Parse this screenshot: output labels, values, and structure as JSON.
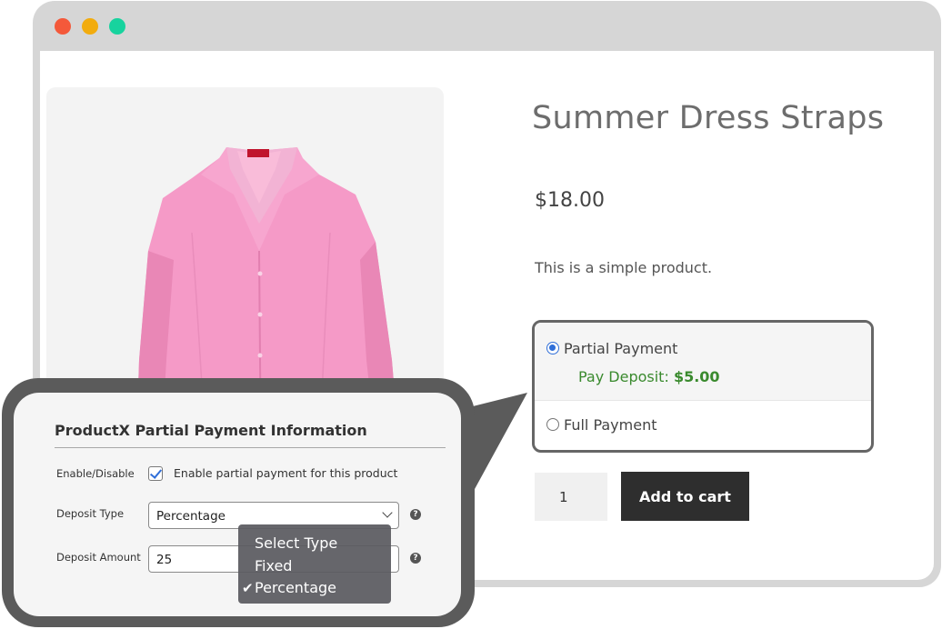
{
  "colors": {
    "window_red": "#f4593a",
    "window_yellow": "#f2ac0e",
    "window_green": "#17d39e",
    "deposit_green": "#3a8a2e",
    "radio_blue": "#2f6ed8",
    "cart_button": "#2e2e2e",
    "callout_dark": "#5b5b5b"
  },
  "product": {
    "image_icon": "pink-blouse-image",
    "title": "Summer Dress Straps",
    "price": "$18.00",
    "description": "This is a simple product."
  },
  "payment": {
    "partial_label": "Partial Payment",
    "deposit_prefix": "Pay Deposit: ",
    "deposit_amount": "$5.00",
    "full_label": "Full Payment",
    "selected": "partial"
  },
  "cart": {
    "quantity": "1",
    "add_label": "Add to cart"
  },
  "settings_panel": {
    "title": "ProductX Partial Payment Information",
    "enable_label": "Enable/Disable",
    "enable_checkbox_label": "Enable partial payment for this product",
    "enabled": true,
    "deposit_type_label": "Deposit Type",
    "deposit_type_value": "Percentage",
    "deposit_amount_label": "Deposit Amount",
    "deposit_amount_value": "25",
    "help_glyph": "?",
    "dropdown_options": [
      "Select Type",
      "Fixed",
      "Percentage"
    ],
    "dropdown_checkmark": "✔"
  }
}
